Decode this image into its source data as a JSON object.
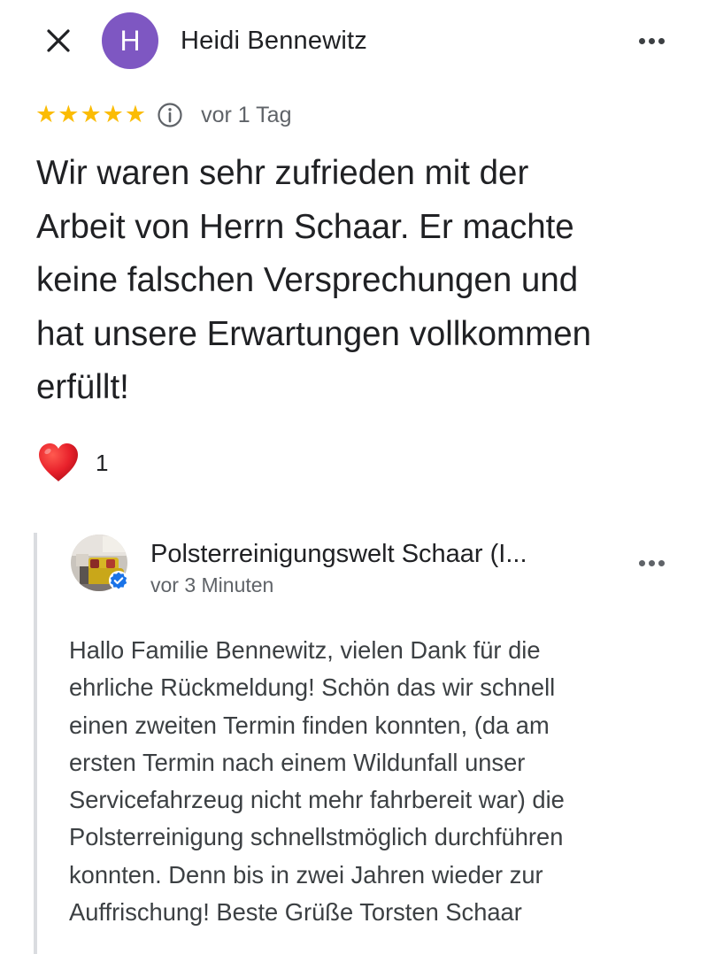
{
  "header": {
    "close_icon": "close-icon",
    "avatar_letter": "H",
    "avatar_color": "#7e57c2",
    "reviewer_name": "Heidi Bennewitz",
    "more_icon": "more-horizontal-icon"
  },
  "review": {
    "rating": 5,
    "max_rating": 5,
    "stars": [
      "★",
      "★",
      "★",
      "★",
      "★"
    ],
    "star_color": "#fbbc04",
    "info_icon": "info-icon",
    "time_ago": "vor 1 Tag",
    "text": "Wir waren sehr zufrieden mit der\nArbeit von Herrn Schaar. Er machte\nkeine falschen Versprechungen und\nhat unsere Erwartungen vollkommen\nerfüllt!",
    "reaction_icon": "heart-icon",
    "reaction_count": "1"
  },
  "owner_reply": {
    "owner_name": "Polsterreinigungswelt Schaar (I...",
    "time_ago": "vor 3 Minuten",
    "verified_icon": "verified-badge-icon",
    "more_icon": "more-horizontal-icon",
    "text": "Hallo Familie Bennewitz, vielen Dank für die\nehrliche Rückmeldung! Schön das wir schnell\neinen zweiten Termin finden konnten, (da am\nersten Termin nach einem Wildunfall unser\nServicefahrzeug nicht mehr fahrbereit war) die\nPolsterreinigung schnellstmöglich durchführen\nkonnten. Denn bis in zwei Jahren wieder zur\nAuffrischung! Beste Grüße Torsten Schaar"
  }
}
